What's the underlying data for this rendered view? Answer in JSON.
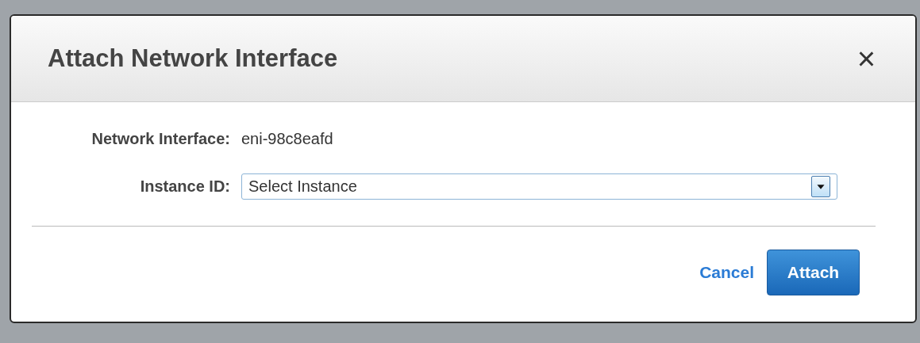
{
  "dialog": {
    "title": "Attach Network Interface",
    "close": "×"
  },
  "fields": [
    {
      "kind": "text",
      "label": "Network Interface:",
      "value": "eni-98c8eafd"
    },
    {
      "kind": "select",
      "label": "Instance ID:",
      "value": "Select Instance"
    }
  ],
  "buttons": [
    {
      "kind": "link",
      "label": "Cancel"
    },
    {
      "kind": "primary",
      "label": "Attach"
    }
  ]
}
